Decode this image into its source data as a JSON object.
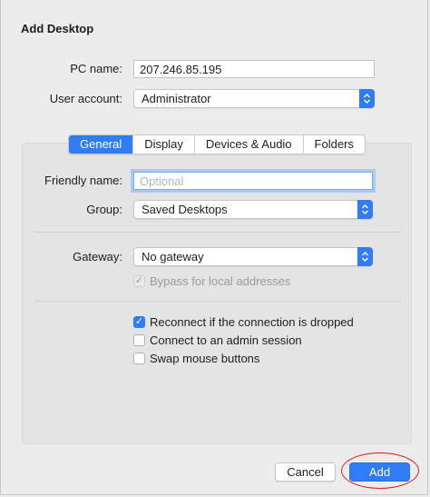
{
  "dialog": {
    "title": "Add Desktop"
  },
  "pc_name": {
    "label": "PC name:",
    "value": "207.246.85.195"
  },
  "user_account": {
    "label": "User account:",
    "value": "Administrator"
  },
  "tabs": [
    {
      "label": "General",
      "active": true
    },
    {
      "label": "Display",
      "active": false
    },
    {
      "label": "Devices & Audio",
      "active": false
    },
    {
      "label": "Folders",
      "active": false
    }
  ],
  "friendly_name": {
    "label": "Friendly name:",
    "placeholder": "Optional",
    "value": ""
  },
  "group": {
    "label": "Group:",
    "value": "Saved Desktops"
  },
  "gateway": {
    "label": "Gateway:",
    "value": "No gateway"
  },
  "bypass": {
    "label": "Bypass for local addresses",
    "checked": true,
    "disabled": true
  },
  "options": {
    "reconnect": {
      "label": "Reconnect if the connection is dropped",
      "checked": true
    },
    "admin_session": {
      "label": "Connect to an admin session",
      "checked": false
    },
    "swap_mouse": {
      "label": "Swap mouse buttons",
      "checked": false
    }
  },
  "buttons": {
    "cancel": "Cancel",
    "add": "Add"
  },
  "icons": {
    "updown": "⌃⌄",
    "check": "✓"
  },
  "colors": {
    "accent": "#2f7cf6",
    "highlight_circle": "#d81e1e"
  }
}
